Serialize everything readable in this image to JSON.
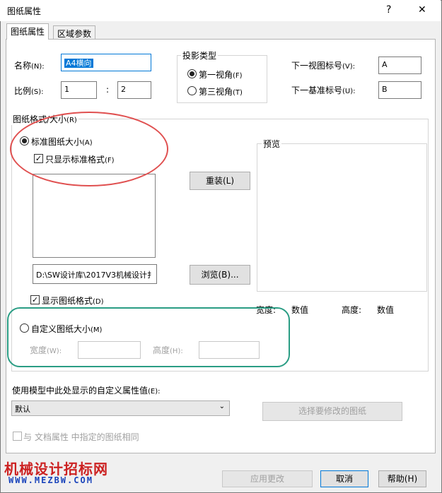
{
  "window": {
    "title": "图纸属性",
    "help_btn": "?",
    "close_btn": "✕"
  },
  "tabs": [
    "图纸属性",
    "区域参数"
  ],
  "name": {
    "label": "名称",
    "mnemonic": "(N):",
    "value": "A4横向"
  },
  "scale": {
    "label": "比例",
    "mnemonic": "(S):",
    "left": "1",
    "colon": ":",
    "right": "2"
  },
  "projection": {
    "title": "投影类型",
    "first": "第一视角",
    "first_key": "(F)",
    "third": "第三视角",
    "third_key": "(T)"
  },
  "next_view": {
    "label": "下一视图标号",
    "mnemonic": "(V):",
    "value": "A"
  },
  "next_datum": {
    "label": "下一基准标号",
    "mnemonic": "(U):",
    "value": "B"
  },
  "sheet_format": {
    "title": "图纸格式/大小",
    "mnemonic": "(R)"
  },
  "standard": {
    "label": "标准图纸大小",
    "mnemonic": "(A)"
  },
  "only_standard": {
    "label": "只显示标准格式",
    "mnemonic": "(F)"
  },
  "reload_btn": "重装(L)",
  "path_value": "D:\\SW设计库\\2017V3机械设计扌",
  "browse_btn": "浏览(B)...",
  "show_format": {
    "label": "显示图纸格式",
    "mnemonic": "(D)"
  },
  "preview": {
    "title": "预览",
    "width_label": "宽度:",
    "width_value": "数值",
    "height_label": "高度:",
    "height_value": "数值"
  },
  "custom": {
    "label": "自定义图纸大小",
    "mnemonic": "(M)",
    "width_label": "宽度",
    "width_key": "(W):",
    "height_label": "高度",
    "height_key": "(H):"
  },
  "model_props": {
    "label": "使用模型中此处显示的自定义属性值",
    "mnemonic": "(E):",
    "value": "默认"
  },
  "select_sheet_btn": "选择要修改的图纸",
  "same_as_doc": "与 文档属性 中指定的图纸相同",
  "buttons": {
    "apply": "应用更改",
    "cancel": "取消",
    "help": "帮助(H)"
  },
  "watermark": {
    "text": "机械设计招标网",
    "url": "WWW.MEZBW.COM"
  },
  "colors": {
    "accent": "#0078d7",
    "red_mark": "#e05050",
    "green_mark": "#2a9d84"
  }
}
